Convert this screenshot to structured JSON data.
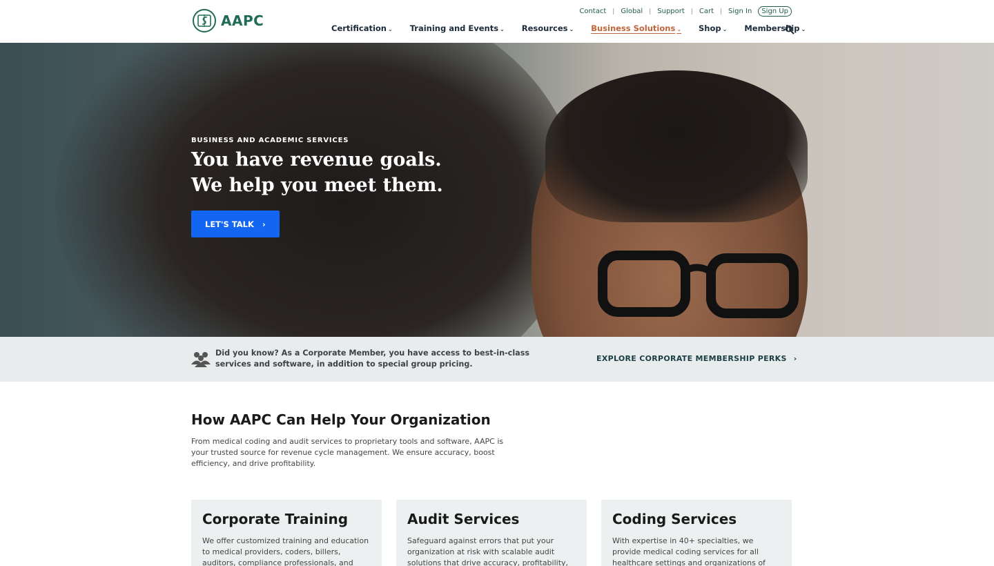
{
  "brand": {
    "name": "AAPC",
    "color": "#1f6b55"
  },
  "utility_nav": [
    {
      "label": "Contact"
    },
    {
      "label": "Global"
    },
    {
      "label": "Support"
    },
    {
      "label": "Cart"
    },
    {
      "label": "Sign In"
    }
  ],
  "signup_label": "Sign Up",
  "main_nav": [
    {
      "label": "Certification"
    },
    {
      "label": "Training and Events"
    },
    {
      "label": "Resources"
    },
    {
      "label": "Business Solutions",
      "active": true
    },
    {
      "label": "Shop"
    },
    {
      "label": "Membership"
    }
  ],
  "hero": {
    "eyebrow": "BUSINESS AND ACADEMIC SERVICES",
    "headline_line1": "You have revenue goals.",
    "headline_line2": "We help you meet them.",
    "cta_label": "LET'S TALK"
  },
  "banner": {
    "text": "Did you know? As a Corporate Member, you have access to best-in-class services and software, in addition to special group pricing.",
    "link_label": "EXPLORE CORPORATE MEMBERSHIP PERKS"
  },
  "section": {
    "title": "How AAPC Can Help Your Organization",
    "description": "From medical coding and audit services to proprietary tools and software, AAPC is your trusted source for revenue cycle management. We ensure accuracy, boost efficiency, and drive profitability."
  },
  "cards": [
    {
      "title": "Corporate Training",
      "description": "We offer customized training and education to medical providers, coders, billers, auditors, compliance professionals, and practice"
    },
    {
      "title": "Audit Services",
      "description": "Safeguard against errors that put your organization at risk with scalable audit solutions that drive accuracy, profitability,"
    },
    {
      "title": "Coding Services",
      "description": "With expertise in 40+ specialties, we provide medical coding services for all healthcare settings and organizations of every size."
    }
  ],
  "colors": {
    "accent_blue": "#1266f1",
    "active_nav": "#c0643a",
    "banner_bg": "#e9ecec",
    "card_bg": "#edf0f0"
  }
}
